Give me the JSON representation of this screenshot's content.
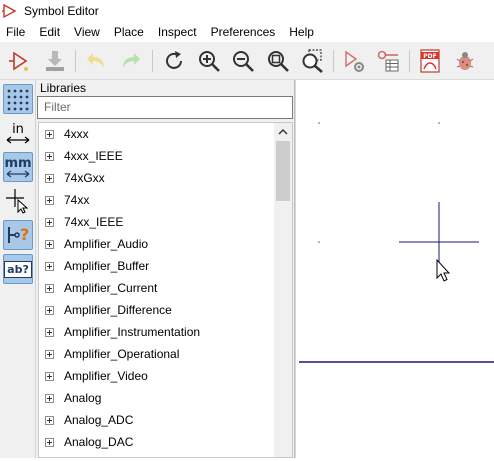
{
  "window": {
    "title": "Symbol Editor"
  },
  "menu": [
    "File",
    "Edit",
    "View",
    "Place",
    "Inspect",
    "Preferences",
    "Help"
  ],
  "toolbar": {
    "icons": [
      "new-symbol-icon",
      "save-icon",
      "undo-icon",
      "redo-icon",
      "refresh-icon",
      "zoom-in-icon",
      "zoom-out-icon",
      "zoom-fit-icon",
      "zoom-selection-icon",
      "symbol-properties-icon",
      "pin-table-icon",
      "export-pdf-icon",
      "symbol-checker-icon"
    ]
  },
  "left_tools": {
    "in_label": "in",
    "mm_label": "mm",
    "help_glyph": "?",
    "text_label": "ab?"
  },
  "libraries": {
    "header": "Libraries",
    "filter_placeholder": "Filter",
    "items": [
      "4xxx",
      "4xxx_IEEE",
      "74xGxx",
      "74xx",
      "74xx_IEEE",
      "Amplifier_Audio",
      "Amplifier_Buffer",
      "Amplifier_Current",
      "Amplifier_Difference",
      "Amplifier_Instrumentation",
      "Amplifier_Operational",
      "Amplifier_Video",
      "Analog",
      "Analog_ADC",
      "Analog_DAC"
    ]
  },
  "colors": {
    "page_border": "#1a1a6e",
    "accent_active": "#a8c8e8",
    "crosshair": "#1a1a6e"
  }
}
